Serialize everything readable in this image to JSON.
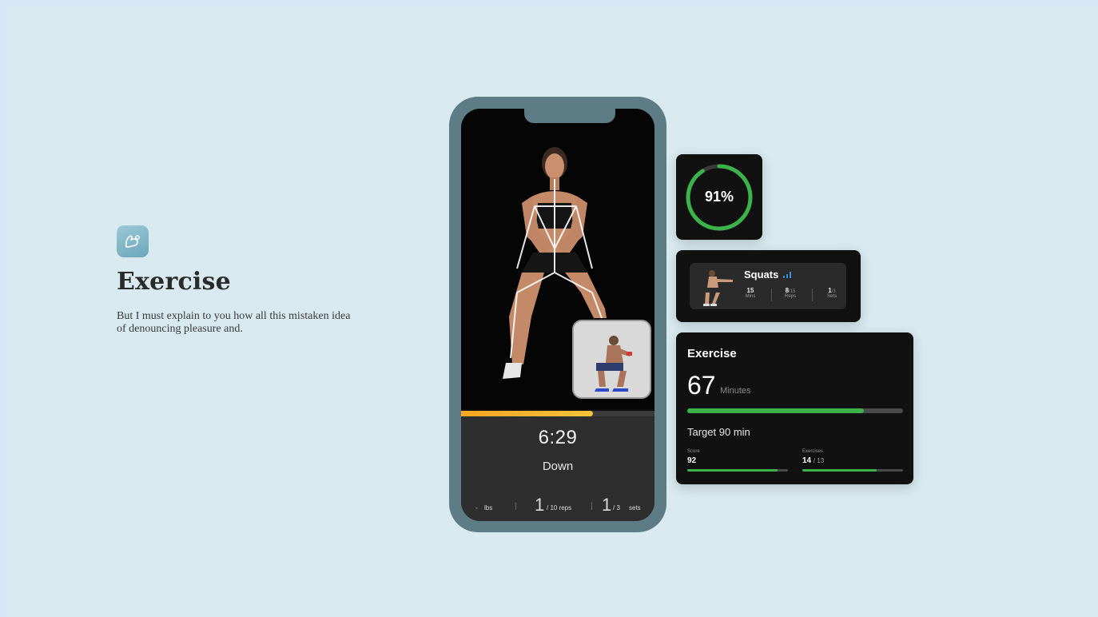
{
  "intro": {
    "icon": "flexed-arm-icon",
    "title": "Exercise",
    "description": "But I must explain to you how all this mistaken idea of denouncing pleasure and."
  },
  "phone": {
    "timer": "6:29",
    "phase": "Down",
    "progress": 0.68,
    "weight_value": "-",
    "weight_unit": "lbs",
    "reps_value": "1",
    "reps_total": "/ 10 reps",
    "sets_value": "1",
    "sets_total": "/ 3",
    "sets_unit": "sets"
  },
  "accuracy_card": {
    "percent_label": "91%",
    "percent": 0.91
  },
  "workout_card": {
    "name": "Squats",
    "stats": [
      {
        "value": "15",
        "unit": "Mins"
      },
      {
        "value": "8",
        "unit": "Reps"
      },
      {
        "value": "1",
        "unit": "Sets"
      }
    ],
    "stat_extras": [
      "/15",
      "/3"
    ]
  },
  "exercise_card": {
    "title": "Exercise",
    "value": "67",
    "unit": "Minutes",
    "progress": 0.82,
    "target": "Target 90 min",
    "score_label": "Score",
    "score_value": "92",
    "score_progress": 0.9,
    "exercises_label": "Exercises",
    "exercises_value": "14",
    "exercises_total": "/ 13",
    "exercises_progress": 0.74
  },
  "colors": {
    "background": "#d8eaf0",
    "accent_green": "#3bb34a",
    "progress_orange": "#f6a623",
    "card": "#111111"
  }
}
